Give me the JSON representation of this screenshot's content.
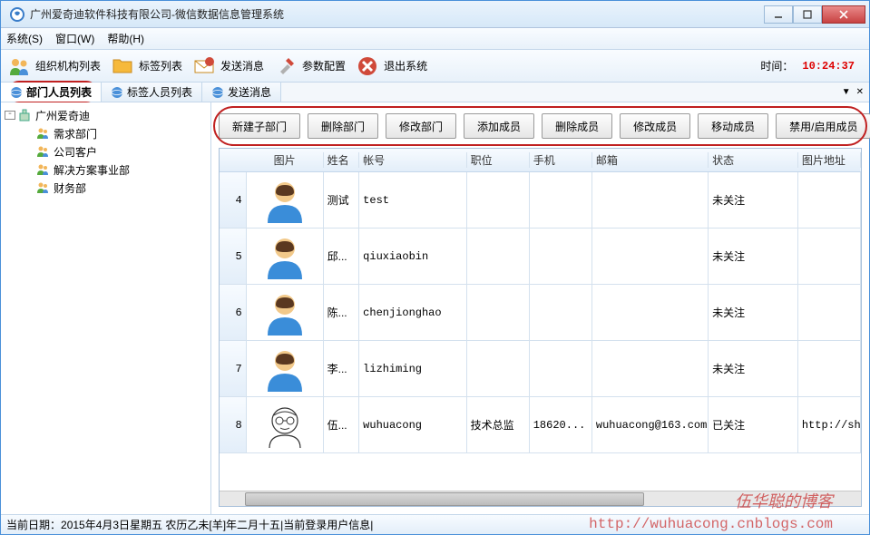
{
  "window_title": "广州爱奇迪软件科技有限公司-微信数据信息管理系统",
  "menu": {
    "system": "系统(S)",
    "window": "窗口(W)",
    "help": "帮助(H)"
  },
  "toolbar": {
    "org": "组织机构列表",
    "tag": "标签列表",
    "send": "发送消息",
    "param": "参数配置",
    "exit": "退出系统",
    "time_label": "时间：",
    "time_value": "10:24:37"
  },
  "tabs": {
    "t0": "部门人员列表",
    "t1": "标签人员列表",
    "t2": "发送消息"
  },
  "tree": {
    "root": "广州爱奇迪",
    "n0": "需求部门",
    "n1": "公司客户",
    "n2": "解决方案事业部",
    "n3": "财务部"
  },
  "actions": {
    "a0": "新建子部门",
    "a1": "删除部门",
    "a2": "修改部门",
    "a3": "添加成员",
    "a4": "删除成员",
    "a5": "修改成员",
    "a6": "移动成员",
    "a7": "禁用/启用成员"
  },
  "columns": {
    "img": "图片",
    "name": "姓名",
    "acct": "帐号",
    "pos": "职位",
    "mob": "手机",
    "mail": "邮箱",
    "stat": "状态",
    "url": "图片地址"
  },
  "rows": [
    {
      "idx": "4",
      "name": "测试",
      "acct": "test",
      "pos": "",
      "mob": "",
      "mail": "",
      "stat": "未关注",
      "url": "",
      "avatar": "blue"
    },
    {
      "idx": "5",
      "name": "邱...",
      "acct": "qiuxiaobin",
      "pos": "",
      "mob": "",
      "mail": "",
      "stat": "未关注",
      "url": "",
      "avatar": "blue"
    },
    {
      "idx": "6",
      "name": "陈...",
      "acct": "chenjionghao",
      "pos": "",
      "mob": "",
      "mail": "",
      "stat": "未关注",
      "url": "",
      "avatar": "blue"
    },
    {
      "idx": "7",
      "name": "李...",
      "acct": "lizhiming",
      "pos": "",
      "mob": "",
      "mail": "",
      "stat": "未关注",
      "url": "",
      "avatar": "blue"
    },
    {
      "idx": "8",
      "name": "伍...",
      "acct": "wuhuacong",
      "pos": "技术总监",
      "mob": "18620...",
      "mail": "wuhuacong@163.com",
      "stat": "已关注",
      "url": "http://sh",
      "avatar": "sketch"
    }
  ],
  "status": {
    "date_label": "当前日期：",
    "date_value": "2015年4月3日星期五 农历乙未[羊]年二月十五",
    "user_label": "当前登录用户信息",
    "sep": " | "
  },
  "watermark": {
    "name": "伍华聪的博客",
    "url": "http://wuhuacong.cnblogs.com"
  }
}
